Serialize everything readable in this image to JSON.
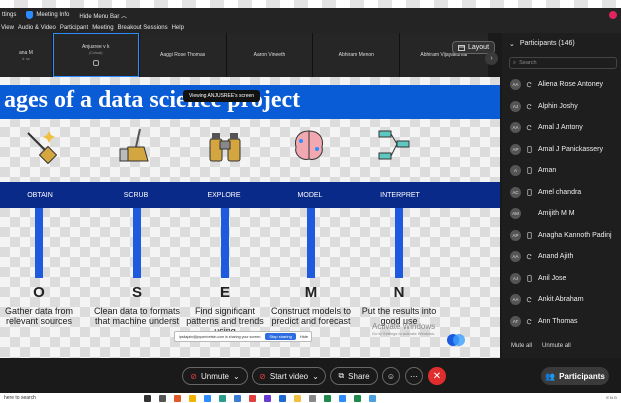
{
  "window": {
    "settings_label": "ttings",
    "meeting_info_label": "Meeting Info",
    "hide_menu_label": "Hide Menu Bar ︿"
  },
  "menu": {
    "items": [
      "View",
      "Audio & Video",
      "Participant",
      "Meeting",
      "Breakout Sessions",
      "Help"
    ]
  },
  "thumbnails": [
    {
      "name": "ana M",
      "sub": "d: ss"
    },
    {
      "name": "Anjusree v k",
      "sub": "(Cohost)"
    },
    {
      "name": "Aaggi Rose Thomas",
      "sub": ""
    },
    {
      "name": "Aaron Vineeth",
      "sub": ""
    },
    {
      "name": "Abhiram Menon",
      "sub": ""
    },
    {
      "name": "Abhiram Vijayakumar",
      "sub": ""
    }
  ],
  "layout_button": "Layout",
  "share": {
    "viewing_label": "Viewing ANJUSREE's screen",
    "slide_title": "ages of a data science project",
    "stages": [
      {
        "label": "OBTAIN",
        "letter": "O",
        "desc": "Gather data from relevant sources"
      },
      {
        "label": "SCRUB",
        "letter": "S",
        "desc": "Clean data to formats that machine underst"
      },
      {
        "label": "EXPLORE",
        "letter": "E",
        "desc": "Find significant patterns and trends using"
      },
      {
        "label": "MODEL",
        "letter": "M",
        "desc": "Construct models to predict and forecast"
      },
      {
        "label": "INTERPRET",
        "letter": "N",
        "desc": "Put the results into good use"
      }
    ],
    "sharing_notice": "ipsitajain@joyserivetsin.com is sharing your screen.",
    "stop_sharing": "Stop sharing",
    "hide": "Hide",
    "activate_title": "Activate Windows",
    "activate_sub": "Go to Settings to activate Windows."
  },
  "panel": {
    "title": "Participants (146)",
    "search_placeholder": "Search",
    "participants": [
      {
        "initials": "AA",
        "name": "Aliena Rose Antoney",
        "icon": "sync-icon"
      },
      {
        "initials": "AJ",
        "name": "Alphin Joshy",
        "icon": "sync-icon"
      },
      {
        "initials": "AA",
        "name": "Amal J Antony",
        "icon": "sync-icon"
      },
      {
        "initials": "AP",
        "name": "Amal J Panickassery",
        "icon": "phone-icon"
      },
      {
        "initials": "A",
        "name": "Aman",
        "icon": "phone-icon"
      },
      {
        "initials": "AC",
        "name": "Amel chandra",
        "icon": "phone-icon"
      },
      {
        "initials": "AM",
        "name": "Amijith M M",
        "icon": ""
      },
      {
        "initials": "AP",
        "name": "Anagha Kannoth Padinj",
        "icon": "phone-icon"
      },
      {
        "initials": "AA",
        "name": "Anand Ajith",
        "icon": "sync-icon"
      },
      {
        "initials": "AJ",
        "name": "Anil Jose",
        "icon": "phone-icon"
      },
      {
        "initials": "AA",
        "name": "Ankit Abraham",
        "icon": "sync-icon"
      },
      {
        "initials": "AT",
        "name": "Ann Thomas",
        "icon": "sync-icon"
      }
    ],
    "mute_all": "Mute all",
    "unmute_all": "Unmute all"
  },
  "toolbar": {
    "unmute": "Unmute",
    "start_video": "Start video",
    "share": "Share",
    "participants": "Participants"
  },
  "taskbar": {
    "search": "here to search",
    "tray": "ENG"
  },
  "colors": {
    "accent": "#2d8cff",
    "leave": "#e02e2e",
    "slide_blue": "#0a5bd6",
    "slide_navy": "#0a2a8a"
  }
}
